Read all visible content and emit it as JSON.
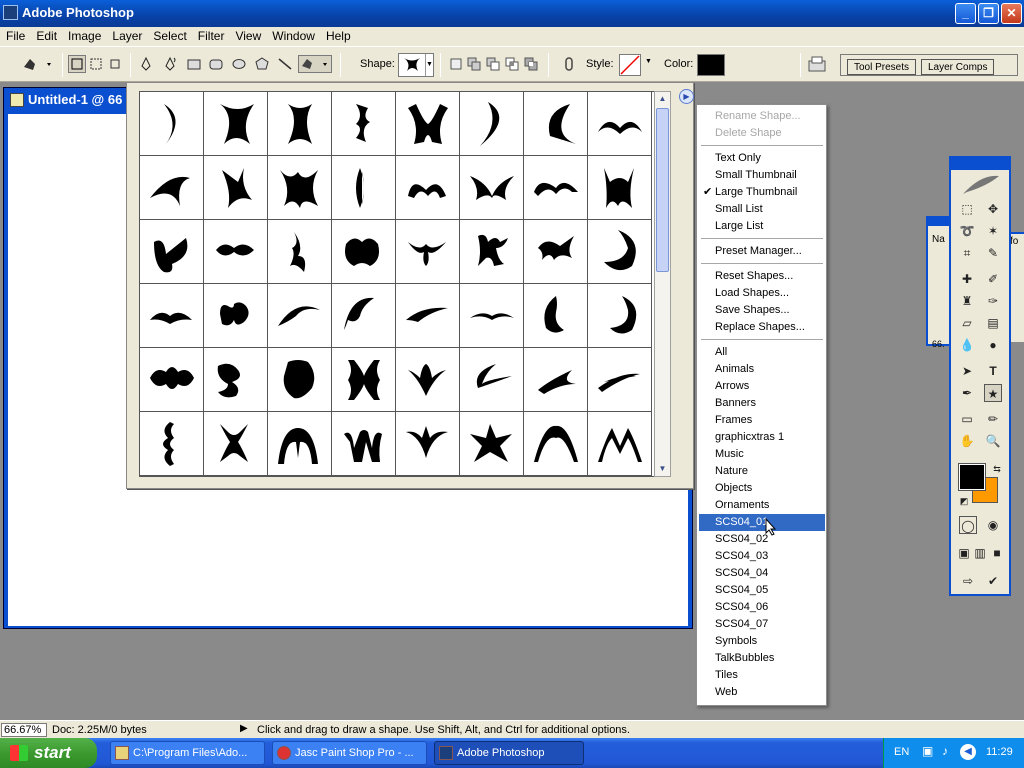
{
  "app": {
    "title": "Adobe Photoshop",
    "menu": [
      "File",
      "Edit",
      "Image",
      "Layer",
      "Select",
      "Filter",
      "View",
      "Window",
      "Help"
    ]
  },
  "options": {
    "shape_label": "Shape:",
    "style_label": "Style:",
    "color_label": "Color:",
    "color_swatch": "#000000",
    "palette_tabs": [
      "Tool Presets",
      "Layer Comps"
    ]
  },
  "document": {
    "title": "Untitled-1 @ 66"
  },
  "shape_picker": {
    "rows": 6,
    "cols": 8
  },
  "context_menu": {
    "items": [
      {
        "label": "Rename Shape...",
        "disabled": true
      },
      {
        "label": "Delete Shape",
        "disabled": true
      },
      {
        "sep": true
      },
      {
        "label": "Text Only"
      },
      {
        "label": "Small Thumbnail"
      },
      {
        "label": "Large Thumbnail",
        "checked": true
      },
      {
        "label": "Small List"
      },
      {
        "label": "Large List"
      },
      {
        "sep": true
      },
      {
        "label": "Preset Manager..."
      },
      {
        "sep": true
      },
      {
        "label": "Reset Shapes..."
      },
      {
        "label": "Load Shapes..."
      },
      {
        "label": "Save Shapes..."
      },
      {
        "label": "Replace Shapes..."
      },
      {
        "sep": true
      },
      {
        "label": "All"
      },
      {
        "label": "Animals"
      },
      {
        "label": "Arrows"
      },
      {
        "label": "Banners"
      },
      {
        "label": "Frames"
      },
      {
        "label": "graphicxtras 1"
      },
      {
        "label": "Music"
      },
      {
        "label": "Nature"
      },
      {
        "label": "Objects"
      },
      {
        "label": "Ornaments"
      },
      {
        "label": "SCS04_01",
        "selected": true
      },
      {
        "label": "SCS04_02"
      },
      {
        "label": "SCS04_03"
      },
      {
        "label": "SCS04_04"
      },
      {
        "label": "SCS04_05"
      },
      {
        "label": "SCS04_06"
      },
      {
        "label": "SCS04_07"
      },
      {
        "label": "Symbols"
      },
      {
        "label": "TalkBubbles"
      },
      {
        "label": "Tiles"
      },
      {
        "label": "Web"
      }
    ]
  },
  "toolbox": {
    "fg_color": "#000000",
    "bg_color": "#ff9900"
  },
  "navigator_stub": {
    "tab": "Na",
    "info_tab": "fo",
    "zoom": "66."
  },
  "status": {
    "zoom": "66.67%",
    "doc": "Doc: 2.25M/0 bytes",
    "hint": "Click and drag to draw a shape. Use Shift, Alt, and Ctrl for additional options."
  },
  "taskbar": {
    "start": "start",
    "tasks": [
      {
        "label": "C:\\Program Files\\Ado...",
        "active": false
      },
      {
        "label": "Jasc Paint Shop Pro - ...",
        "active": false,
        "badge": "8"
      },
      {
        "label": "Adobe Photoshop",
        "active": true
      }
    ],
    "lang": "EN",
    "clock": "11:29"
  }
}
